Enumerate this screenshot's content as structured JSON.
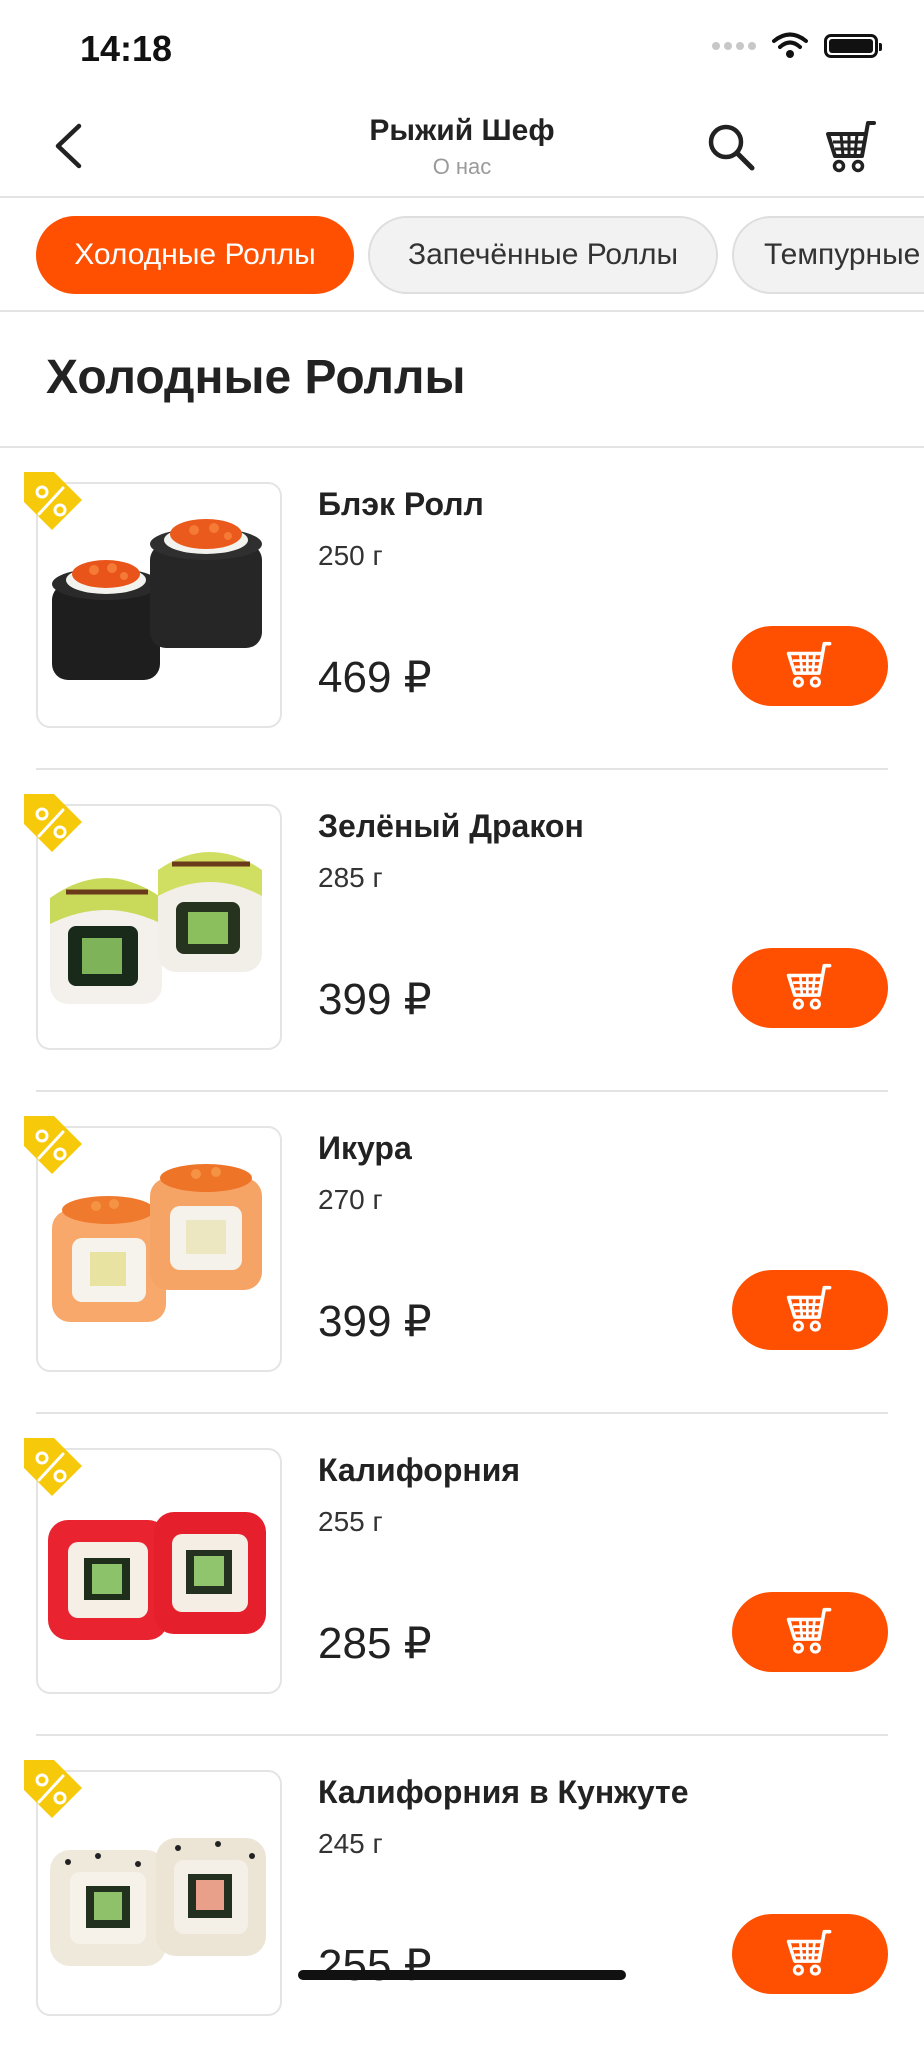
{
  "status_bar": {
    "time": "14:18"
  },
  "header": {
    "title": "Рыжий Шеф",
    "subtitle": "О нас"
  },
  "categories": [
    {
      "label": "Холодные Роллы",
      "active": true
    },
    {
      "label": "Запечённые Роллы",
      "active": false
    },
    {
      "label": "Темпурные Роллы",
      "active": false
    }
  ],
  "section": {
    "title": "Холодные Роллы"
  },
  "products": [
    {
      "name": "Блэк Ролл",
      "weight": "250 г",
      "price": "469 ₽"
    },
    {
      "name": "Зелёный Дракон",
      "weight": "285 г",
      "price": "399 ₽"
    },
    {
      "name": "Икура",
      "weight": "270 г",
      "price": "399 ₽"
    },
    {
      "name": "Калифорния",
      "weight": "255 г",
      "price": "285 ₽"
    },
    {
      "name": "Калифорния в Кунжуте",
      "weight": "245 г",
      "price": "255 ₽"
    }
  ],
  "colors": {
    "accent": "#fe5000",
    "discount_tag": "#f7c90b"
  },
  "icons": [
    "back-arrow-icon",
    "search-icon",
    "cart-icon",
    "discount-percent-icon",
    "wifi-icon",
    "battery-icon"
  ]
}
